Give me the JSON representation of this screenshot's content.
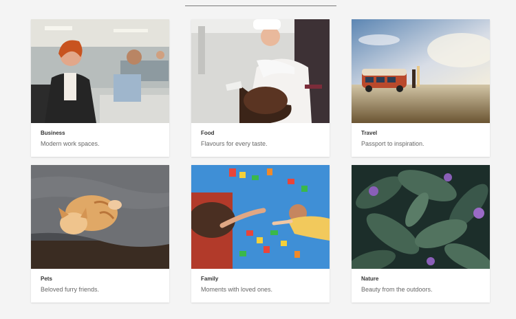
{
  "cards": [
    {
      "title": "Business",
      "description": "Modern work spaces.",
      "image": "business-office-photo"
    },
    {
      "title": "Food",
      "description": "Flavours for every taste.",
      "image": "chef-cooking-photo"
    },
    {
      "title": "Travel",
      "description": "Passport to inspiration.",
      "image": "van-beach-sunset-photo"
    },
    {
      "title": "Pets",
      "description": "Beloved furry friends.",
      "image": "sleeping-kitten-photo"
    },
    {
      "title": "Family",
      "description": "Moments with loved ones.",
      "image": "family-playing-blocks-photo"
    },
    {
      "title": "Nature",
      "description": "Beauty from the outdoors.",
      "image": "green-leaves-flowers-photo"
    }
  ]
}
